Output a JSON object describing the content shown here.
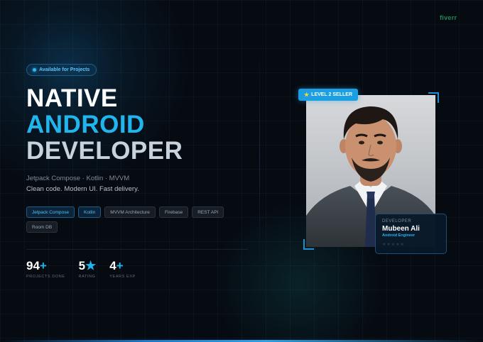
{
  "brand": {
    "name": "fiverr"
  },
  "availability": {
    "label": "Available for Projects"
  },
  "headline": {
    "line1": "NATIVE",
    "line2": "ANDROID",
    "line3": "DEVELOPER"
  },
  "subtitle": {
    "stack": "Jetpack Compose · Kotlin · MVVM",
    "pitch": "Clean code. Modern UI. Fast delivery."
  },
  "tags": [
    {
      "label": "Jetpack Compose",
      "highlighted": true
    },
    {
      "label": "Kotlin",
      "highlighted": true
    },
    {
      "label": "MVVM Architecture",
      "highlighted": false
    },
    {
      "label": "Firebase",
      "highlighted": false
    },
    {
      "label": "REST API",
      "highlighted": false
    },
    {
      "label": "Room DB",
      "highlighted": false
    }
  ],
  "stats": [
    {
      "value": "94",
      "suffix": "+",
      "label": "PROJECTS DONE"
    },
    {
      "value": "5",
      "suffix": "★",
      "label": "RATING"
    },
    {
      "value": "4",
      "suffix": "+",
      "label": "YEARS EXP"
    }
  ],
  "seller_badge": {
    "icon": "star-icon",
    "label": "LEVEL 2 SELLER"
  },
  "profile": {
    "role": "DEVELOPER",
    "name": "Mubeen Ali",
    "title": "Android Engineer",
    "rating_stars": "★★★★★"
  },
  "colors": {
    "accent": "#1fb6ee",
    "background": "#060b12",
    "badge": "#1b9fe3",
    "brand": "#1e8a5a"
  }
}
